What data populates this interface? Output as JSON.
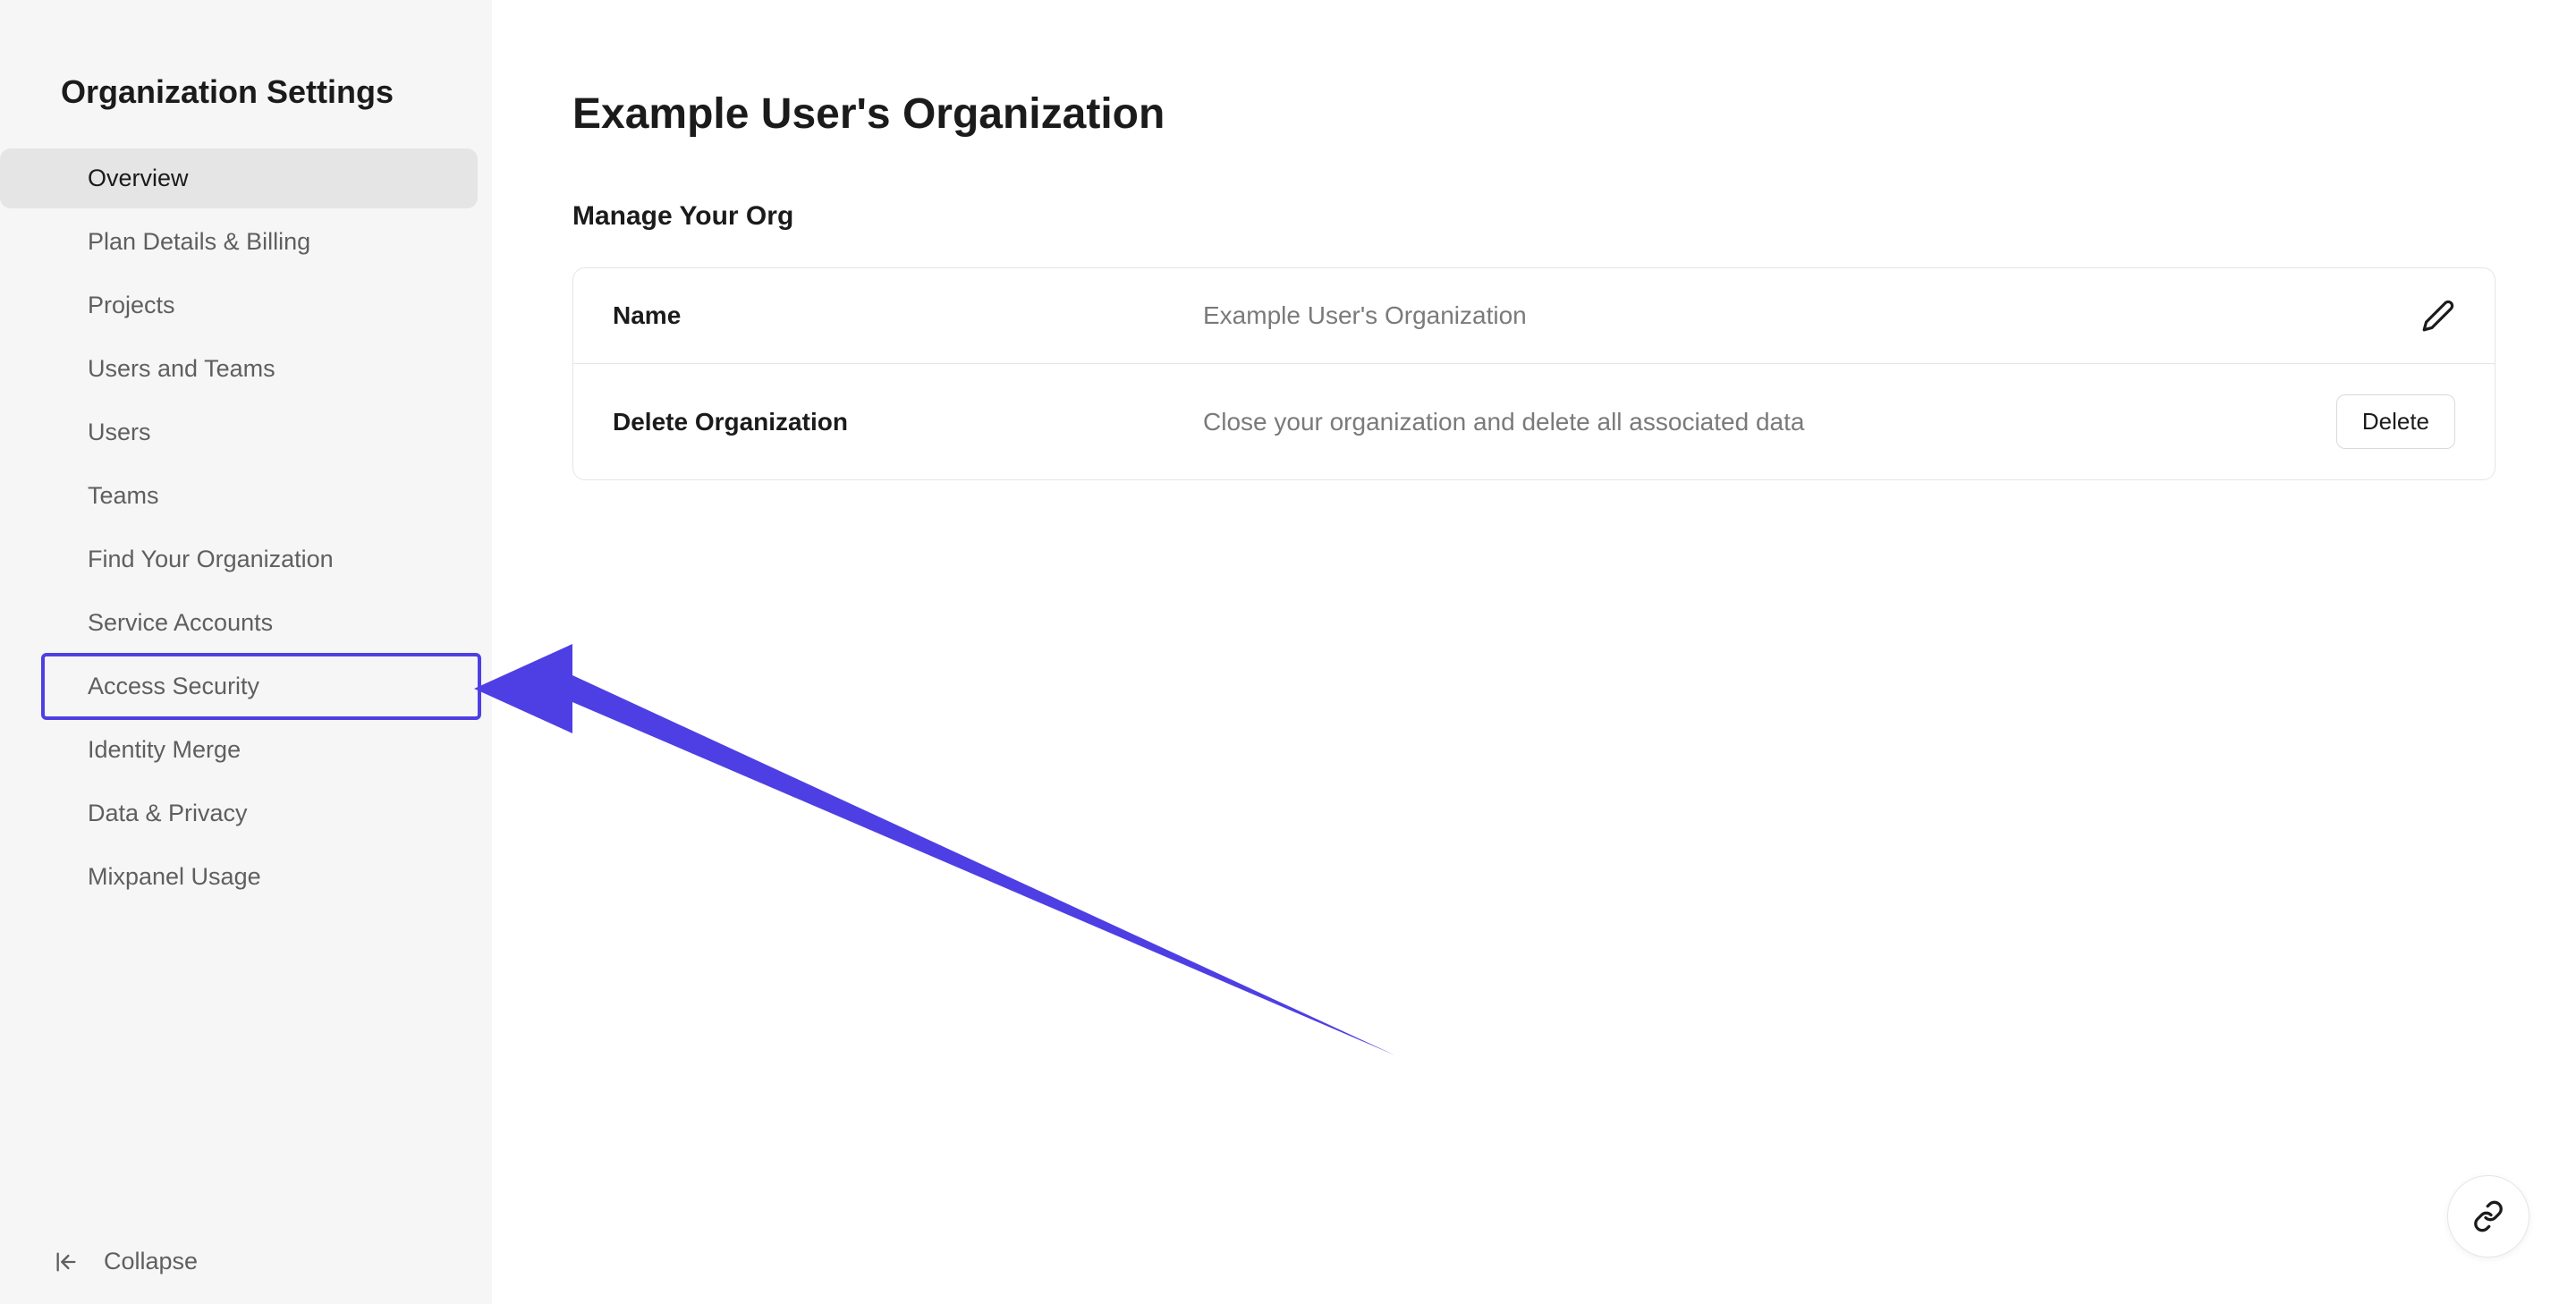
{
  "sidebar": {
    "title": "Organization Settings",
    "items": [
      {
        "label": "Overview",
        "active": true
      },
      {
        "label": "Plan Details & Billing"
      },
      {
        "label": "Projects"
      },
      {
        "label": "Users and Teams"
      },
      {
        "label": "Users"
      },
      {
        "label": "Teams"
      },
      {
        "label": "Find Your Organization"
      },
      {
        "label": "Service Accounts"
      },
      {
        "label": "Access Security",
        "highlighted": true
      },
      {
        "label": "Identity Merge"
      },
      {
        "label": "Data & Privacy"
      },
      {
        "label": "Mixpanel Usage"
      }
    ],
    "collapse_label": "Collapse"
  },
  "main": {
    "page_title": "Example User's Organization",
    "section_title": "Manage Your Org",
    "rows": {
      "name": {
        "label": "Name",
        "value": "Example User's Organization"
      },
      "delete": {
        "label": "Delete Organization",
        "description": "Close your organization and delete all associated data",
        "button": "Delete"
      }
    }
  }
}
